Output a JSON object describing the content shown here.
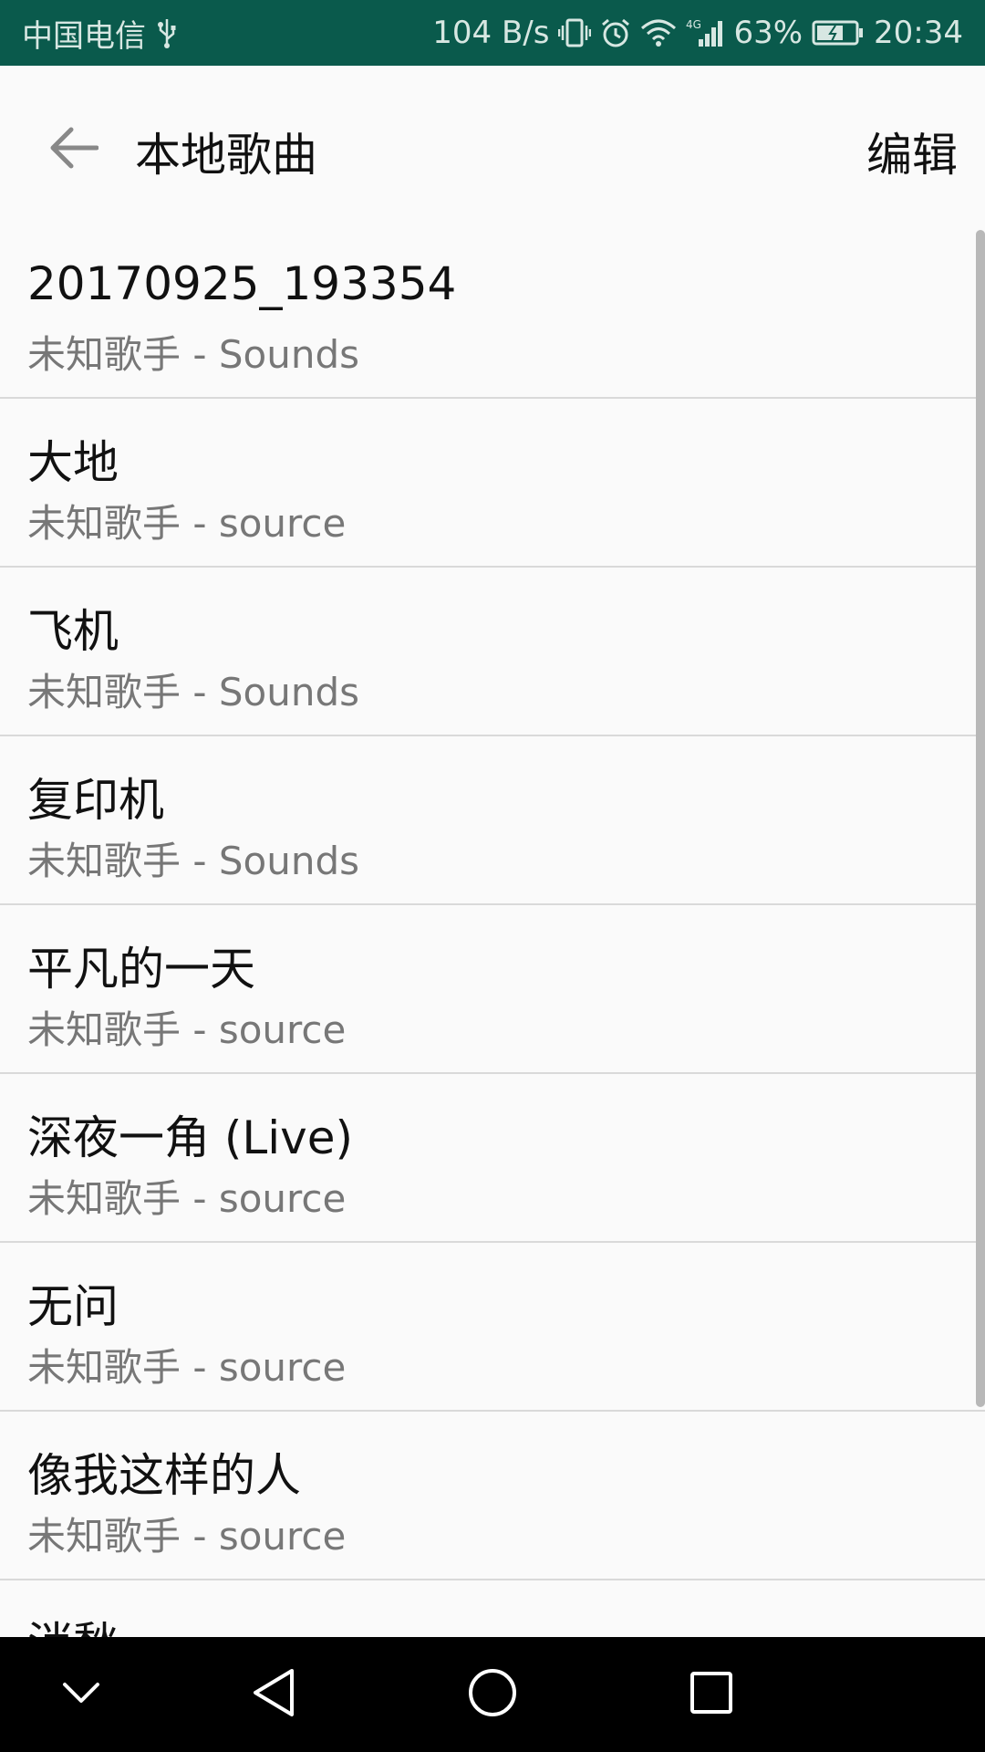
{
  "status_bar": {
    "carrier": "中国电信",
    "speed": "104 B/s",
    "network": "4G",
    "battery_percent": "63%",
    "time": "20:34",
    "colors": {
      "background": "#0a5a4c",
      "text": "#d7e7e2"
    }
  },
  "header": {
    "title": "本地歌曲",
    "edit_label": "编辑"
  },
  "songs": [
    {
      "title": "20170925_193354",
      "subtitle": "未知歌手 - Sounds"
    },
    {
      "title": "大地",
      "subtitle": "未知歌手 - source"
    },
    {
      "title": "飞机",
      "subtitle": "未知歌手 - Sounds"
    },
    {
      "title": "复印机",
      "subtitle": "未知歌手 - Sounds"
    },
    {
      "title": "平凡的一天",
      "subtitle": "未知歌手 - source"
    },
    {
      "title": "深夜一角 (Live)",
      "subtitle": "未知歌手 - source"
    },
    {
      "title": "无问",
      "subtitle": "未知歌手 - source"
    },
    {
      "title": "像我这样的人",
      "subtitle": "未知歌手 - source"
    },
    {
      "title": "消愁",
      "subtitle": ""
    }
  ],
  "icons": {
    "back": "arrow-left-icon",
    "nav_collapse": "chevron-down-icon",
    "nav_back": "triangle-back-icon",
    "nav_home": "circle-home-icon",
    "nav_recents": "square-recents-icon"
  }
}
